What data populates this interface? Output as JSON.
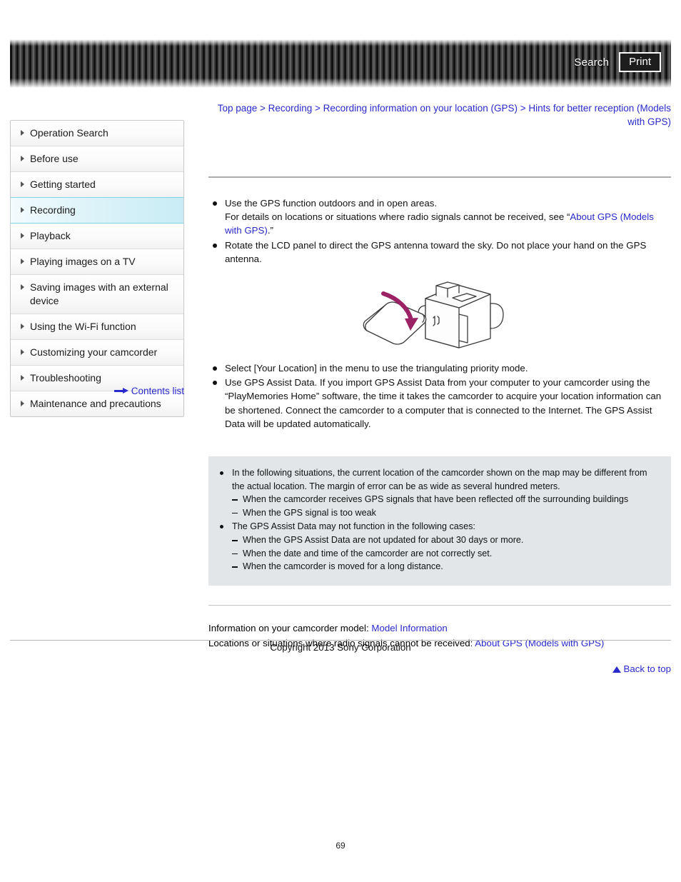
{
  "header": {
    "search_label": "Search",
    "print_label": "Print"
  },
  "breadcrumb": {
    "items": [
      "Top page",
      "Recording",
      "Recording information on your location (GPS)",
      "Hints for better reception (Models with GPS)"
    ],
    "separator": " > ",
    "line1_part1": "Top page",
    "line1_part2": "Recording",
    "line1_part3": "Recording information on your location (GPS)",
    "line1_part4": "Hints for better reception",
    "line2": "(Models with GPS)"
  },
  "sidebar": {
    "items": [
      {
        "label": "Operation Search",
        "active": false
      },
      {
        "label": "Before use",
        "active": false
      },
      {
        "label": "Getting started",
        "active": false
      },
      {
        "label": "Recording",
        "active": true
      },
      {
        "label": "Playback",
        "active": false
      },
      {
        "label": "Playing images on a TV",
        "active": false
      },
      {
        "label": "Saving images with an external device",
        "active": false
      },
      {
        "label": "Using the Wi-Fi function",
        "active": false
      },
      {
        "label": "Customizing your camcorder",
        "active": false
      },
      {
        "label": "Troubleshooting",
        "active": false
      },
      {
        "label": "Maintenance and precautions",
        "active": false
      }
    ],
    "contents_list_label": "Contents list"
  },
  "main": {
    "bullets_top": [
      {
        "text_1": "Use the GPS function outdoors and in open areas.",
        "text_2": "For details on locations or situations where radio signals cannot be received, see “",
        "link": "About GPS (Models with GPS)",
        "text_3": ".”"
      },
      {
        "text_1": "Rotate the LCD panel to direct the GPS antenna toward the sky. Do not place your hand on the GPS antenna."
      }
    ],
    "bullets_mid": [
      {
        "text_1": "Select [Your Location] in the menu to use the triangulating priority mode."
      },
      {
        "text_1": "Use GPS Assist Data. If you import GPS Assist Data from your computer to your camcorder using the “PlayMemories Home” software, the time it takes the camcorder to acquire your location information can be shortened. Connect the camcorder to a computer that is connected to the Internet. The GPS Assist Data will be updated automatically."
      }
    ],
    "note_box": {
      "bullet_1": "In the following situations, the current location of the camcorder shown on the map may be different from the actual location. The margin of error can be as wide as several hundred meters.",
      "bullet_1_subs": [
        "When the camcorder receives GPS signals that have been reflected off the surrounding buildings",
        "When the GPS signal is too weak"
      ],
      "bullet_2": "The GPS Assist Data may not function in the following cases:",
      "bullet_2_subs": [
        "When the GPS Assist Data are not updated for about 30 days or more.",
        "When the date and time of the camcorder are not correctly set.",
        "When the camcorder is moved for a long distance."
      ]
    },
    "links_block": {
      "line1_label": "Information on your camcorder model: ",
      "line1_link": "Model Information",
      "line2_label": "Locations or situations where radio signals cannot be received: ",
      "line2_link": "About GPS (Models with GPS)"
    },
    "back_to_top_label": "Back to top"
  },
  "footer": {
    "copyright": "Copyright 2013 Sony Corporation",
    "page_number": "69"
  },
  "colors": {
    "link": "#2a2acc",
    "note_bg": "#e2e6e8",
    "active_item": "#c8ecf5",
    "arrow_magenta": "#9b2264"
  }
}
